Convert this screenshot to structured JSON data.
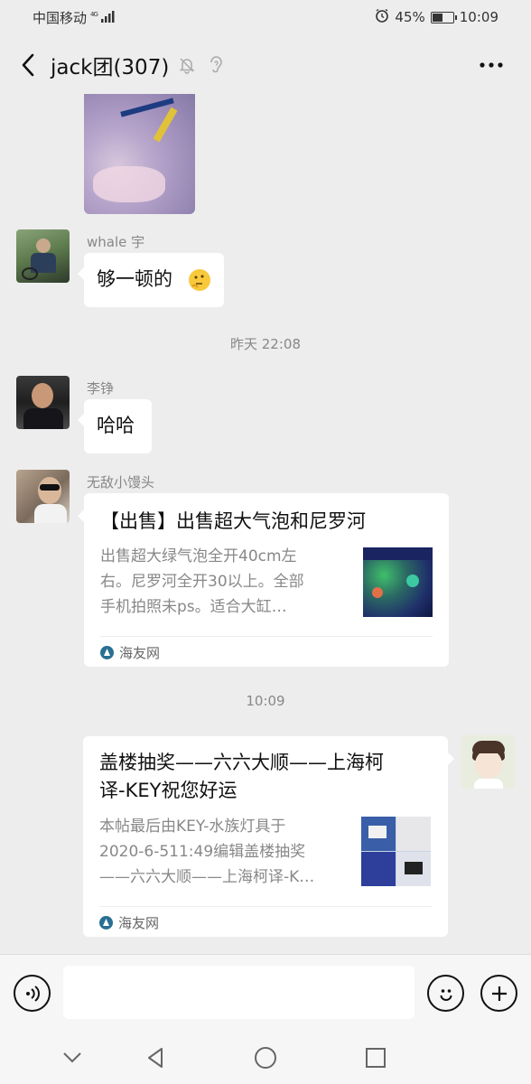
{
  "status_bar": {
    "carrier": "中国移动",
    "network": "4G",
    "battery_percent": "45%",
    "battery_level": 0.45,
    "time": "10:09"
  },
  "header": {
    "title": "jack团(307)",
    "icons": [
      "back-icon",
      "mute-bell-icon",
      "ear-icon",
      "more-icon"
    ]
  },
  "messages": [
    {
      "type": "image",
      "sender": "",
      "icon": "photo"
    },
    {
      "type": "text",
      "sender": "whale 宇",
      "text": "够一顿的",
      "emoji": "thinking-face"
    },
    {
      "type": "timestamp",
      "text": "昨天 22:08"
    },
    {
      "type": "text",
      "sender": "李铮",
      "text": "哈哈"
    },
    {
      "type": "link_card",
      "sender": "无敌小馒头",
      "title": "【出售】出售超大气泡和尼罗河",
      "description_lines": [
        "出售超大绿气泡全开40cm左",
        "右。尼罗河全开30以上。全部",
        "手机拍照未ps。适合大缸…"
      ],
      "source": "海友网"
    },
    {
      "type": "timestamp",
      "text": "10:09"
    },
    {
      "type": "link_card",
      "sender": "me",
      "title_lines": [
        "盖楼抽奖——六六大顺——上海柯",
        "译-KEY祝您好运"
      ],
      "description_lines": [
        "本帖最后由KEY-水族灯具于",
        "2020-6-511:49编辑盖楼抽奖",
        "——六六大顺——上海柯译-K…"
      ],
      "source": "海友网"
    }
  ],
  "input_bar": {
    "placeholder": "",
    "icons": [
      "voice-icon",
      "emoji-icon",
      "plus-icon"
    ]
  },
  "nav_bar": {
    "icons": [
      "collapse-icon",
      "back-triangle-icon",
      "home-circle-icon",
      "recents-square-icon"
    ]
  }
}
